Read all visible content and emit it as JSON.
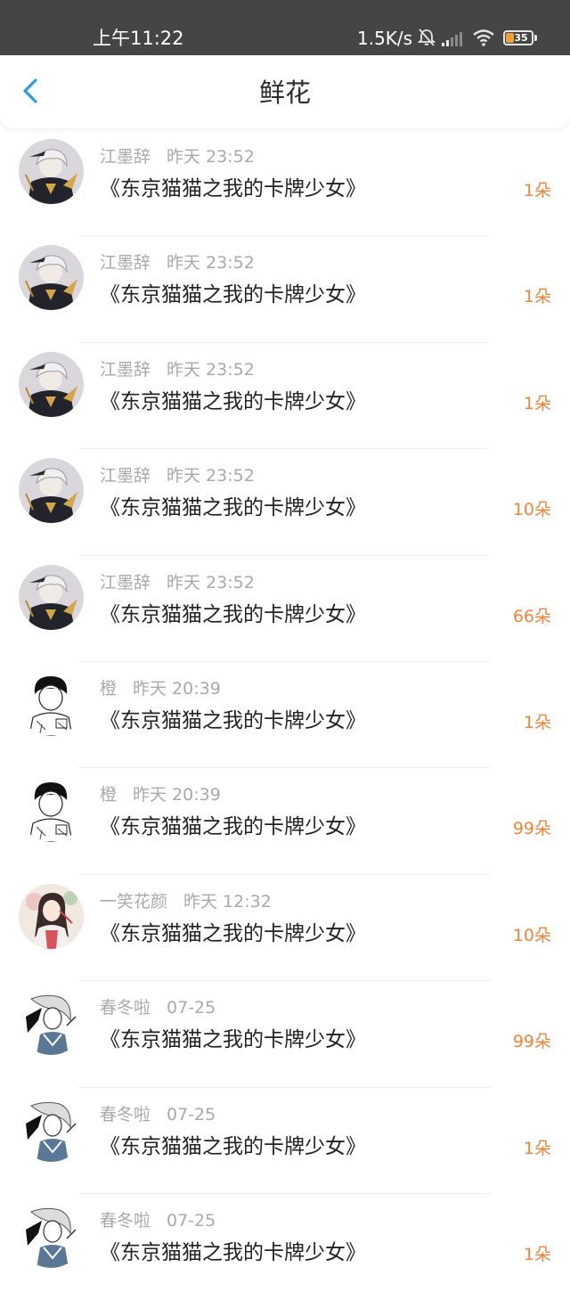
{
  "status_bar": {
    "time": "上午11:22",
    "network_speed": "1.5K/s",
    "battery_level": "35",
    "icons": [
      "mute-icon",
      "signal-icon",
      "wifi-icon",
      "battery-icon"
    ]
  },
  "header": {
    "title": "鲜花",
    "back_icon": "chevron-left-icon"
  },
  "colors": {
    "accent_blue": "#2f9be6",
    "count_orange": "#f0843a",
    "meta_gray": "#a9a9a9",
    "status_bar_bg": "#454545"
  },
  "flowers": [
    {
      "user": "江墨辞",
      "time": "昨天 23:52",
      "book": "《东京猫猫之我的卡牌少女》",
      "count": "1朵",
      "avatar": "dark-anime-avatar"
    },
    {
      "user": "江墨辞",
      "time": "昨天 23:52",
      "book": "《东京猫猫之我的卡牌少女》",
      "count": "1朵",
      "avatar": "dark-anime-avatar"
    },
    {
      "user": "江墨辞",
      "time": "昨天 23:52",
      "book": "《东京猫猫之我的卡牌少女》",
      "count": "1朵",
      "avatar": "dark-anime-avatar"
    },
    {
      "user": "江墨辞",
      "time": "昨天 23:52",
      "book": "《东京猫猫之我的卡牌少女》",
      "count": "10朵",
      "avatar": "dark-anime-avatar"
    },
    {
      "user": "江墨辞",
      "time": "昨天 23:52",
      "book": "《东京猫猫之我的卡牌少女》",
      "count": "66朵",
      "avatar": "dark-anime-avatar"
    },
    {
      "user": "橙",
      "time": "昨天 20:39",
      "book": "《东京猫猫之我的卡牌少女》",
      "count": "1朵",
      "avatar": "sketch-boy-avatar"
    },
    {
      "user": "橙",
      "time": "昨天 20:39",
      "book": "《东京猫猫之我的卡牌少女》",
      "count": "99朵",
      "avatar": "sketch-boy-avatar"
    },
    {
      "user": "一笑花颜",
      "time": "昨天 12:32",
      "book": "《东京猫猫之我的卡牌少女》",
      "count": "10朵",
      "avatar": "painted-girl-avatar"
    },
    {
      "user": "春冬啦",
      "time": "07-25",
      "book": "《东京猫猫之我的卡牌少女》",
      "count": "99朵",
      "avatar": "ink-swordsman-avatar"
    },
    {
      "user": "春冬啦",
      "time": "07-25",
      "book": "《东京猫猫之我的卡牌少女》",
      "count": "1朵",
      "avatar": "ink-swordsman-avatar"
    },
    {
      "user": "春冬啦",
      "time": "07-25",
      "book": "《东京猫猫之我的卡牌少女》",
      "count": "1朵",
      "avatar": "ink-swordsman-avatar"
    }
  ]
}
